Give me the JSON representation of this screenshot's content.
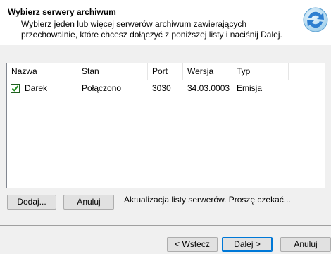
{
  "header": {
    "title": "Wybierz serwery archiwum",
    "description": "Wybierz jeden lub więcej serwerów archiwum zawierających przechowalnie, które chcesz dołączyć z poniższej listy i naciśnij Dalej."
  },
  "list": {
    "columns": [
      "Nazwa",
      "Stan",
      "Port",
      "Wersja",
      "Typ"
    ],
    "rows": [
      {
        "checked": true,
        "name": "Darek",
        "state": "Połączono",
        "port": "3030",
        "version": "34.03.0003",
        "type": "Emisja"
      }
    ]
  },
  "actions": {
    "add_label": "Dodaj...",
    "cancel_label": "Anuluj",
    "status": "Aktualizacja listy serwerów. Proszę czekać..."
  },
  "footer": {
    "back_label": "< Wstecz",
    "next_label": "Dalej >",
    "cancel_label": "Anuluj"
  },
  "colors": {
    "checkmark": "#1a8a1a",
    "default_button_border": "#0078d7"
  }
}
